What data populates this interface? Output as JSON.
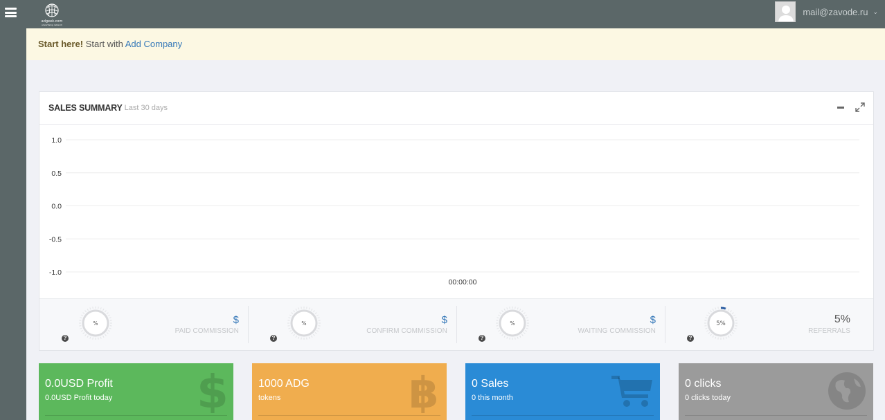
{
  "app": {
    "menu_icon": "hamburger-icon",
    "logo_text": "adgeek.com",
    "logo_tagline": "advertising network"
  },
  "user": {
    "email": "mail@zavode.ru",
    "avatar_icon": "avatar-placeholder"
  },
  "notice": {
    "lead": "Start here!",
    "text": "Start with",
    "link": "Add Company"
  },
  "sales_summary": {
    "title": "SALES SUMMARY",
    "subtitle": "Last 30 days",
    "tools": [
      "minimize-icon",
      "expand-icon"
    ]
  },
  "chart_data": {
    "type": "line",
    "title": "",
    "xlabel": "",
    "ylabel": "",
    "x": [
      "00:00:00"
    ],
    "series": [],
    "yticks": [
      "1.0",
      "0.5",
      "0.0",
      "-0.5",
      "-1.0"
    ],
    "ylim": [
      -1.0,
      1.0
    ],
    "grid": true
  },
  "stats": [
    {
      "gauge": "%",
      "value": "$",
      "label": "PAID COMMISSION",
      "percent": 0
    },
    {
      "gauge": "%",
      "value": "$",
      "label": "CONFIRM COMMISSION",
      "percent": 0
    },
    {
      "gauge": "%",
      "value": "$",
      "label": "WAITING COMMISSION",
      "percent": 0
    },
    {
      "gauge": "5%",
      "value": "5%",
      "label": "REFERRALS",
      "percent": 5
    }
  ],
  "tiles": [
    {
      "title": "0.0USD Profit",
      "subtitle": "0.0USD Profit today",
      "icon": "dollar-icon",
      "color": "#5cb85c"
    },
    {
      "title": "1000 ADG",
      "subtitle": "tokens",
      "icon": "bitcoin-icon",
      "color": "#f0ad4e"
    },
    {
      "title": "0 Sales",
      "subtitle": "0 this month",
      "icon": "cart-icon",
      "color": "#2a8bd6"
    },
    {
      "title": "0 clicks",
      "subtitle": "0 clicks today",
      "icon": "globe-icon",
      "color": "#9b9b9b"
    }
  ],
  "colors": {
    "topbar": "#5b6768",
    "notice_bg": "#fcf8e3",
    "link": "#3578b8",
    "gauge_progress": "#2d5fa3"
  }
}
